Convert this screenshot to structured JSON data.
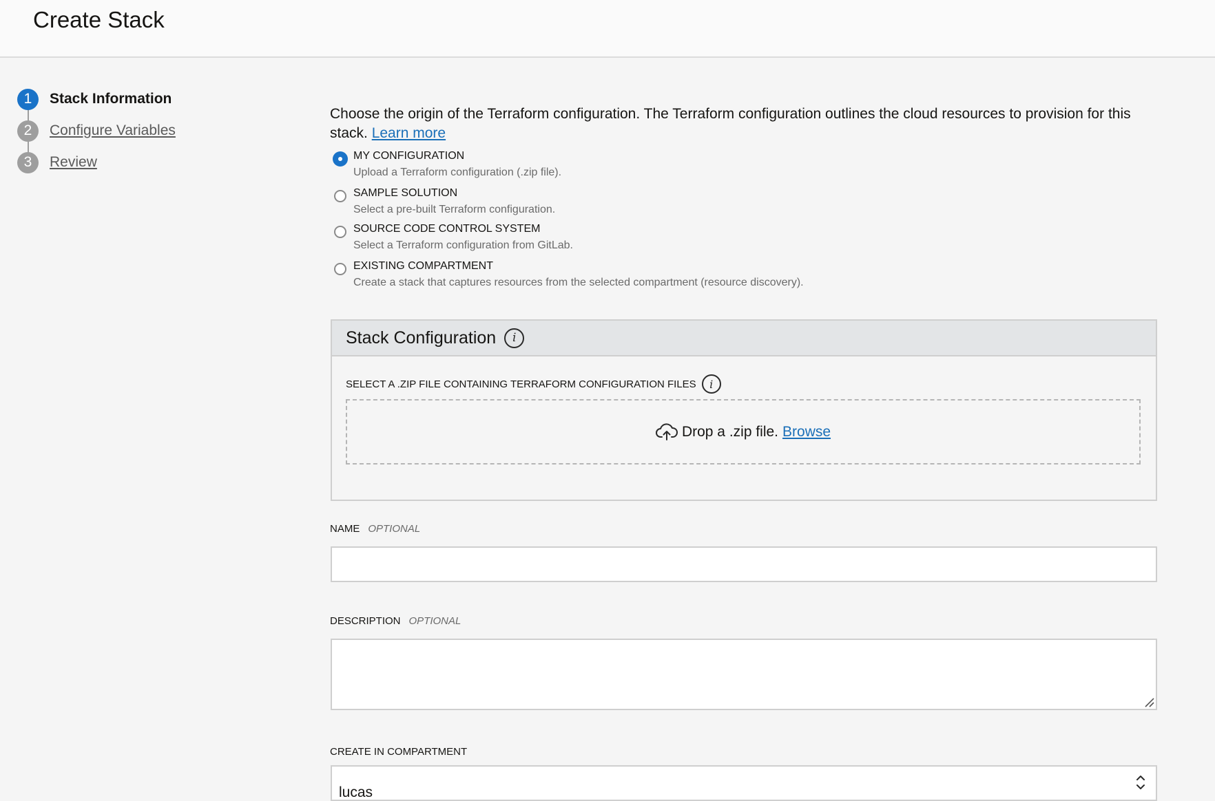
{
  "header": {
    "title": "Create Stack"
  },
  "stepper": {
    "steps": [
      {
        "number": "1",
        "label": "Stack Information"
      },
      {
        "number": "2",
        "label": "Configure Variables"
      },
      {
        "number": "3",
        "label": "Review"
      }
    ],
    "active_index": 0
  },
  "intro": {
    "text": "Choose the origin of the Terraform configuration. The Terraform configuration outlines the cloud resources to provision for this stack.",
    "learn_more": "Learn more"
  },
  "origin_options": [
    {
      "title": "MY CONFIGURATION",
      "description": "Upload a Terraform configuration (.zip file).",
      "checked": true
    },
    {
      "title": "SAMPLE SOLUTION",
      "description": "Select a pre-built Terraform configuration.",
      "checked": false
    },
    {
      "title": "SOURCE CODE CONTROL SYSTEM",
      "description": "Select a Terraform configuration from GitLab.",
      "checked": false
    },
    {
      "title": "EXISTING COMPARTMENT",
      "description": "Create a stack that captures resources from the selected compartment (resource discovery).",
      "checked": false
    }
  ],
  "stack_config": {
    "title": "Stack Configuration",
    "zip_label": "SELECT A .ZIP FILE CONTAINING TERRAFORM CONFIGURATION FILES",
    "drop_text": "Drop a .zip file.",
    "browse": "Browse"
  },
  "fields": {
    "name": {
      "label": "NAME",
      "optional": "OPTIONAL",
      "value": ""
    },
    "description": {
      "label": "DESCRIPTION",
      "optional": "OPTIONAL",
      "value": ""
    },
    "compartment": {
      "label": "CREATE IN COMPARTMENT",
      "value": "lucas"
    }
  },
  "colors": {
    "accent": "#1a73c8",
    "link": "#1a6fb8",
    "inactive_step": "#9e9e9e"
  }
}
